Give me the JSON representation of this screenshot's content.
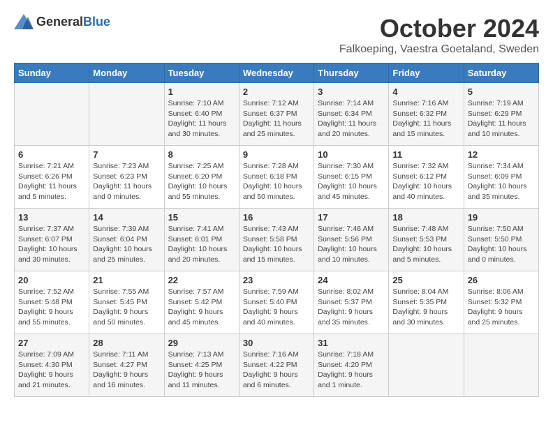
{
  "header": {
    "logo_general": "General",
    "logo_blue": "Blue",
    "month_title": "October 2024",
    "location": "Falkoeping, Vaestra Goetaland, Sweden"
  },
  "weekdays": [
    "Sunday",
    "Monday",
    "Tuesday",
    "Wednesday",
    "Thursday",
    "Friday",
    "Saturday"
  ],
  "weeks": [
    [
      {
        "day": "",
        "info": ""
      },
      {
        "day": "",
        "info": ""
      },
      {
        "day": "1",
        "info": "Sunrise: 7:10 AM\nSunset: 6:40 PM\nDaylight: 11 hours and 30 minutes."
      },
      {
        "day": "2",
        "info": "Sunrise: 7:12 AM\nSunset: 6:37 PM\nDaylight: 11 hours and 25 minutes."
      },
      {
        "day": "3",
        "info": "Sunrise: 7:14 AM\nSunset: 6:34 PM\nDaylight: 11 hours and 20 minutes."
      },
      {
        "day": "4",
        "info": "Sunrise: 7:16 AM\nSunset: 6:32 PM\nDaylight: 11 hours and 15 minutes."
      },
      {
        "day": "5",
        "info": "Sunrise: 7:19 AM\nSunset: 6:29 PM\nDaylight: 11 hours and 10 minutes."
      }
    ],
    [
      {
        "day": "6",
        "info": "Sunrise: 7:21 AM\nSunset: 6:26 PM\nDaylight: 11 hours and 5 minutes."
      },
      {
        "day": "7",
        "info": "Sunrise: 7:23 AM\nSunset: 6:23 PM\nDaylight: 11 hours and 0 minutes."
      },
      {
        "day": "8",
        "info": "Sunrise: 7:25 AM\nSunset: 6:20 PM\nDaylight: 10 hours and 55 minutes."
      },
      {
        "day": "9",
        "info": "Sunrise: 7:28 AM\nSunset: 6:18 PM\nDaylight: 10 hours and 50 minutes."
      },
      {
        "day": "10",
        "info": "Sunrise: 7:30 AM\nSunset: 6:15 PM\nDaylight: 10 hours and 45 minutes."
      },
      {
        "day": "11",
        "info": "Sunrise: 7:32 AM\nSunset: 6:12 PM\nDaylight: 10 hours and 40 minutes."
      },
      {
        "day": "12",
        "info": "Sunrise: 7:34 AM\nSunset: 6:09 PM\nDaylight: 10 hours and 35 minutes."
      }
    ],
    [
      {
        "day": "13",
        "info": "Sunrise: 7:37 AM\nSunset: 6:07 PM\nDaylight: 10 hours and 30 minutes."
      },
      {
        "day": "14",
        "info": "Sunrise: 7:39 AM\nSunset: 6:04 PM\nDaylight: 10 hours and 25 minutes."
      },
      {
        "day": "15",
        "info": "Sunrise: 7:41 AM\nSunset: 6:01 PM\nDaylight: 10 hours and 20 minutes."
      },
      {
        "day": "16",
        "info": "Sunrise: 7:43 AM\nSunset: 5:58 PM\nDaylight: 10 hours and 15 minutes."
      },
      {
        "day": "17",
        "info": "Sunrise: 7:46 AM\nSunset: 5:56 PM\nDaylight: 10 hours and 10 minutes."
      },
      {
        "day": "18",
        "info": "Sunrise: 7:48 AM\nSunset: 5:53 PM\nDaylight: 10 hours and 5 minutes."
      },
      {
        "day": "19",
        "info": "Sunrise: 7:50 AM\nSunset: 5:50 PM\nDaylight: 10 hours and 0 minutes."
      }
    ],
    [
      {
        "day": "20",
        "info": "Sunrise: 7:52 AM\nSunset: 5:48 PM\nDaylight: 9 hours and 55 minutes."
      },
      {
        "day": "21",
        "info": "Sunrise: 7:55 AM\nSunset: 5:45 PM\nDaylight: 9 hours and 50 minutes."
      },
      {
        "day": "22",
        "info": "Sunrise: 7:57 AM\nSunset: 5:42 PM\nDaylight: 9 hours and 45 minutes."
      },
      {
        "day": "23",
        "info": "Sunrise: 7:59 AM\nSunset: 5:40 PM\nDaylight: 9 hours and 40 minutes."
      },
      {
        "day": "24",
        "info": "Sunrise: 8:02 AM\nSunset: 5:37 PM\nDaylight: 9 hours and 35 minutes."
      },
      {
        "day": "25",
        "info": "Sunrise: 8:04 AM\nSunset: 5:35 PM\nDaylight: 9 hours and 30 minutes."
      },
      {
        "day": "26",
        "info": "Sunrise: 8:06 AM\nSunset: 5:32 PM\nDaylight: 9 hours and 25 minutes."
      }
    ],
    [
      {
        "day": "27",
        "info": "Sunrise: 7:09 AM\nSunset: 4:30 PM\nDaylight: 9 hours and 21 minutes."
      },
      {
        "day": "28",
        "info": "Sunrise: 7:11 AM\nSunset: 4:27 PM\nDaylight: 9 hours and 16 minutes."
      },
      {
        "day": "29",
        "info": "Sunrise: 7:13 AM\nSunset: 4:25 PM\nDaylight: 9 hours and 11 minutes."
      },
      {
        "day": "30",
        "info": "Sunrise: 7:16 AM\nSunset: 4:22 PM\nDaylight: 9 hours and 6 minutes."
      },
      {
        "day": "31",
        "info": "Sunrise: 7:18 AM\nSunset: 4:20 PM\nDaylight: 9 hours and 1 minute."
      },
      {
        "day": "",
        "info": ""
      },
      {
        "day": "",
        "info": ""
      }
    ]
  ]
}
